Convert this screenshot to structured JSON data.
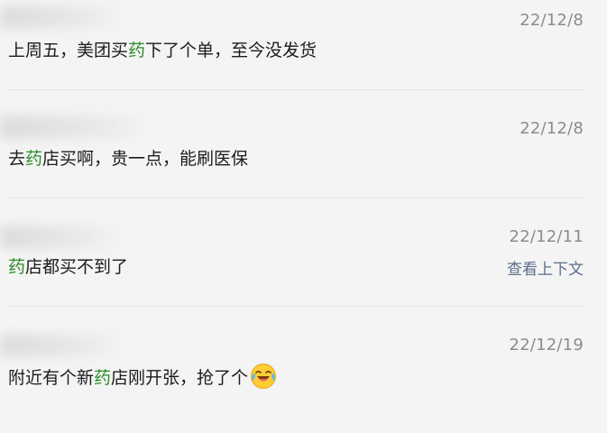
{
  "comments": [
    {
      "date": "22/12/8",
      "pre": "上周五，美团买",
      "hl": "药",
      "post": "下了个单，至今没发货"
    },
    {
      "date": "22/12/8",
      "pre": "去",
      "hl": "药",
      "post": "店买啊，贵一点，能刷医保"
    },
    {
      "date": "22/12/11",
      "pre": "",
      "hl": "药",
      "post": "店都买不到了",
      "link": "查看上下文"
    },
    {
      "date": "22/12/19",
      "pre": "附近有个新",
      "hl": "药",
      "post": "店刚开张，抢了个",
      "emoji": "laugh-cry-emoji"
    }
  ],
  "colors": {
    "highlight": "#2a8a2a",
    "date": "#8c8c8c",
    "link": "#5b6d8e"
  }
}
